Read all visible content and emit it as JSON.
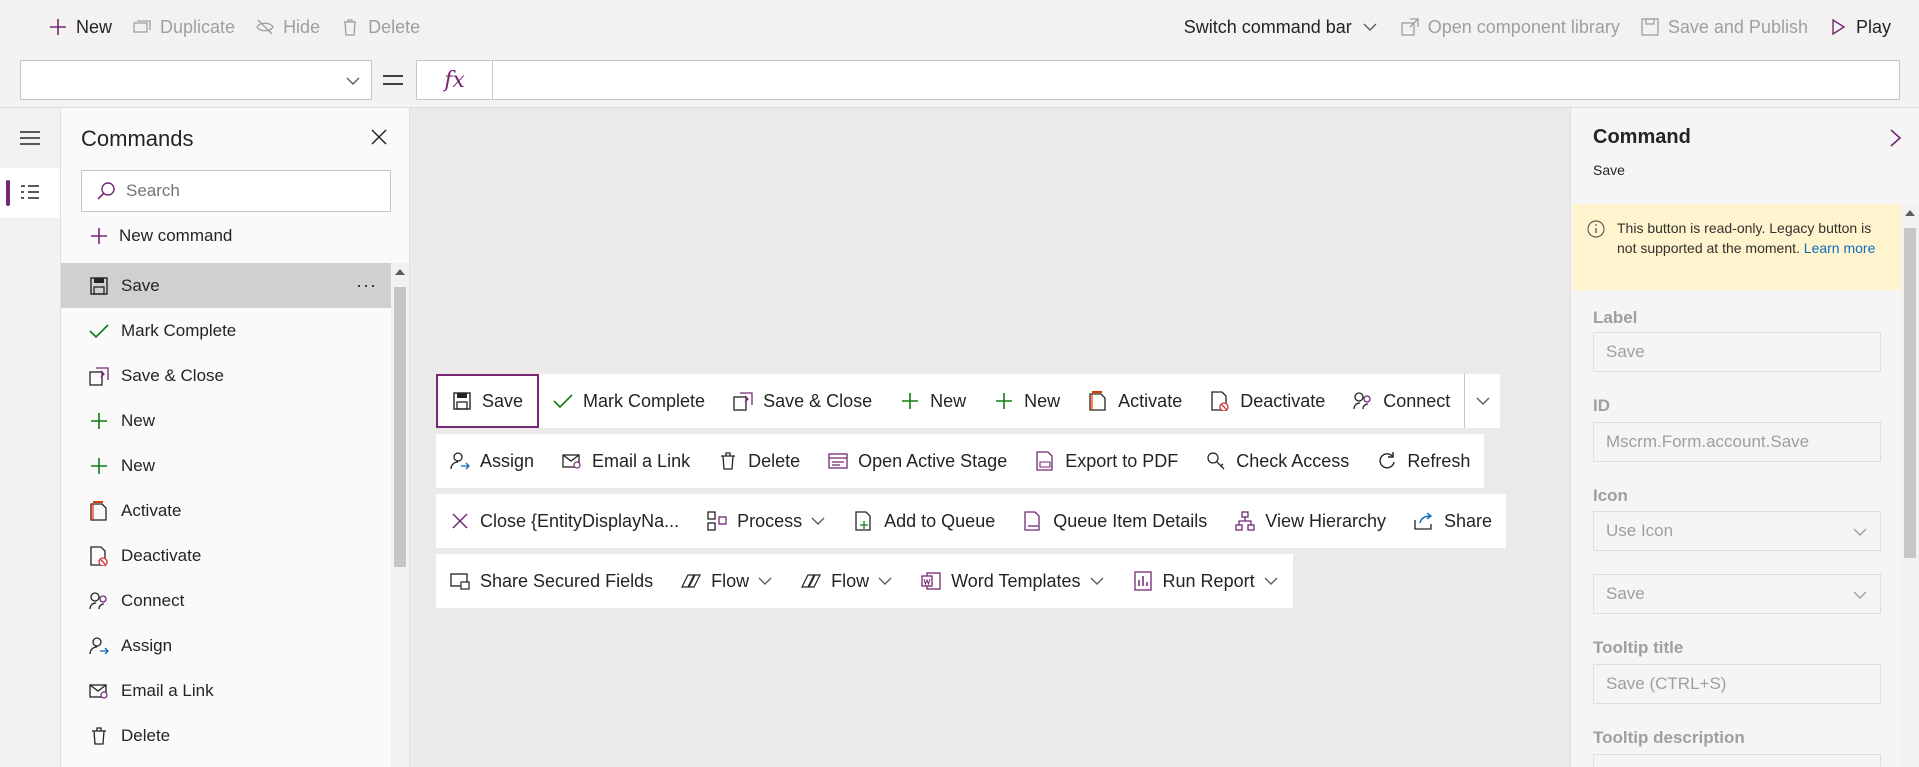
{
  "topbar": {
    "new": "New",
    "duplicate": "Duplicate",
    "hide": "Hide",
    "delete": "Delete",
    "switch_command_bar": "Switch command bar",
    "open_component_library": "Open component library",
    "save_and_publish": "Save and Publish",
    "play": "Play"
  },
  "formula": {
    "property_value": "",
    "fx_label": "fx",
    "formula_value": ""
  },
  "commands": {
    "title": "Commands",
    "search_placeholder": "Search",
    "new_command": "New command",
    "items": [
      {
        "label": "Save",
        "icon": "save-icon"
      },
      {
        "label": "Mark Complete",
        "icon": "checkmark-icon"
      },
      {
        "label": "Save & Close",
        "icon": "save-close-icon"
      },
      {
        "label": "New",
        "icon": "plus-icon"
      },
      {
        "label": "New",
        "icon": "plus-icon"
      },
      {
        "label": "Activate",
        "icon": "activate-icon"
      },
      {
        "label": "Deactivate",
        "icon": "deactivate-icon"
      },
      {
        "label": "Connect",
        "icon": "connect-icon"
      },
      {
        "label": "Assign",
        "icon": "assign-icon"
      },
      {
        "label": "Email a Link",
        "icon": "email-link-icon"
      },
      {
        "label": "Delete",
        "icon": "trash-icon"
      }
    ],
    "more": "···"
  },
  "canvas": {
    "row1": [
      "Save",
      "Mark Complete",
      "Save & Close",
      "New",
      "New",
      "Activate",
      "Deactivate",
      "Connect"
    ],
    "row2": [
      "Assign",
      "Email a Link",
      "Delete",
      "Open Active Stage",
      "Export to PDF",
      "Check Access",
      "Refresh"
    ],
    "row3": [
      "Close {EntityDisplayNa...",
      "Process",
      "Add to Queue",
      "Queue Item Details",
      "View Hierarchy",
      "Share"
    ],
    "row4": [
      "Share Secured Fields",
      "Flow",
      "Flow",
      "Word Templates",
      "Run Report"
    ]
  },
  "props": {
    "title": "Command",
    "subtitle": "Save",
    "notice_text": "This button is read-only. Legacy button is not supported at the moment.",
    "notice_link": "Learn more",
    "label_label": "Label",
    "label_value": "Save",
    "id_label": "ID",
    "id_value": "Mscrm.Form.account.Save",
    "icon_label": "Icon",
    "icon_select": "Use Icon",
    "icon_value": "Save",
    "tooltip_title_label": "Tooltip title",
    "tooltip_title_value": "Save (CTRL+S)",
    "tooltip_desc_label": "Tooltip description"
  },
  "colors": {
    "accent": "#742774",
    "green": "#107c10",
    "notice_bg": "#fff4ce"
  }
}
